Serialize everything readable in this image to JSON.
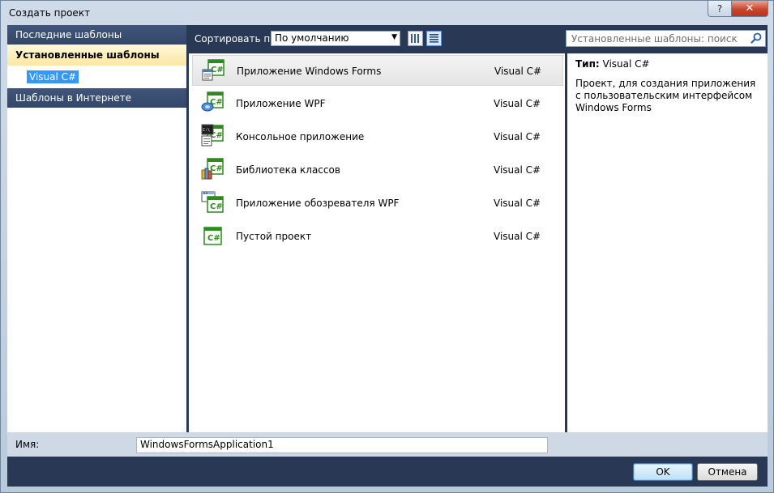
{
  "window": {
    "title": "Создать проект",
    "help_glyph": "?",
    "close_glyph": "✕"
  },
  "left_panel": {
    "recent": "Последние шаблоны",
    "installed": "Установленные шаблоны",
    "language": "Visual C#",
    "online": "Шаблоны в Интернете"
  },
  "toolbar": {
    "sort_label": "Сортировать по:",
    "sort_value": "По умолчанию"
  },
  "search": {
    "placeholder": "Установленные шаблоны: поиск"
  },
  "templates": [
    {
      "name": "Приложение Windows Forms",
      "lang": "Visual C#",
      "icon": "winforms-icon"
    },
    {
      "name": "Приложение WPF",
      "lang": "Visual C#",
      "icon": "wpf-icon"
    },
    {
      "name": "Консольное приложение",
      "lang": "Visual C#",
      "icon": "console-icon"
    },
    {
      "name": "Библиотека классов",
      "lang": "Visual C#",
      "icon": "class-library-icon"
    },
    {
      "name": "Приложение обозревателя WPF",
      "lang": "Visual C#",
      "icon": "wpf-browser-icon"
    },
    {
      "name": "Пустой проект",
      "lang": "Visual C#",
      "icon": "empty-project-icon"
    }
  ],
  "details": {
    "type_label": "Тип:",
    "type_value": "Visual C#",
    "description": "Проект, для создания приложения с пользовательским интерфейсом Windows Forms"
  },
  "name_field": {
    "label": "Имя:",
    "value": "WindowsFormsApplication1"
  },
  "buttons": {
    "ok": "OK",
    "cancel": "Отмена"
  },
  "colors": {
    "header": "#3b4f73",
    "selection": "#3399ff",
    "csharp_green": "#2f8a1e"
  }
}
